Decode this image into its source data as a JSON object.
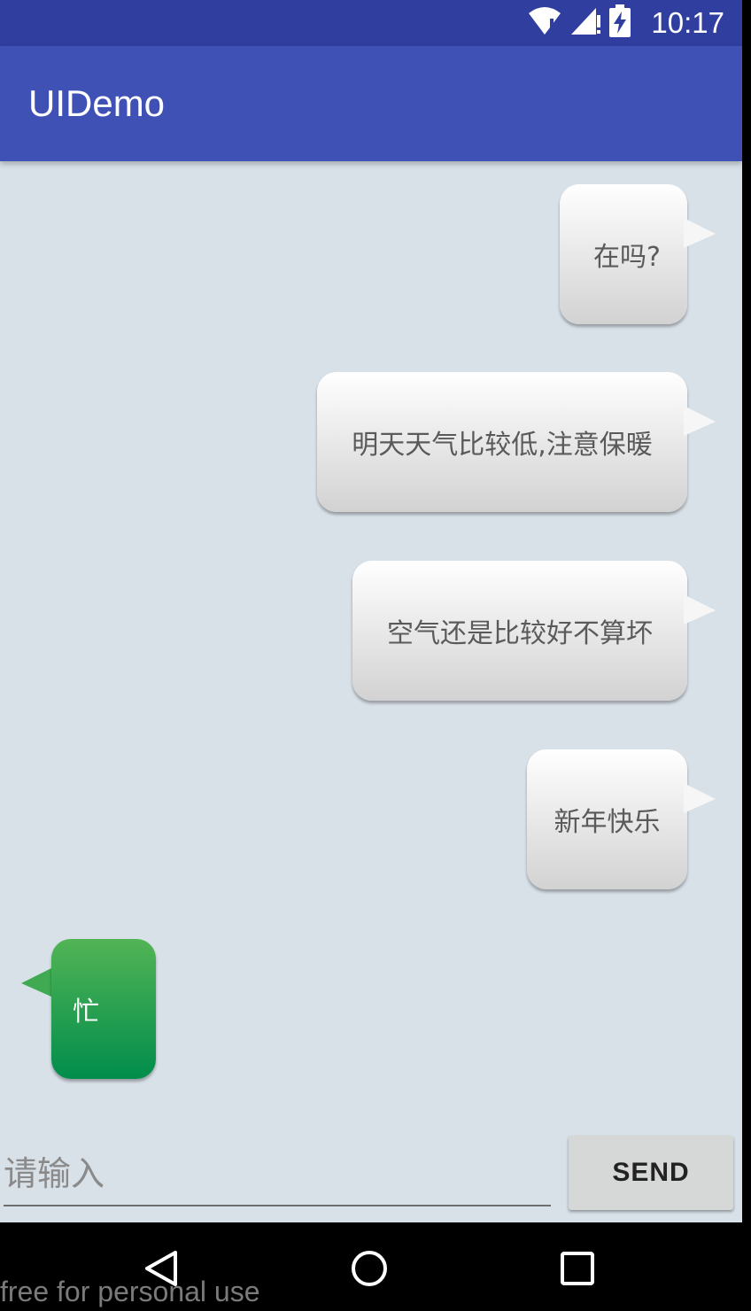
{
  "status_bar": {
    "time": "10:17",
    "icons": [
      "wifi-icon",
      "signal-icon",
      "battery-charging-icon"
    ]
  },
  "app_bar": {
    "title": "UIDemo"
  },
  "messages": [
    {
      "side": "right",
      "text": "在吗?"
    },
    {
      "side": "right",
      "text": "明天天气比较低,注意保暖"
    },
    {
      "side": "right",
      "text": "空气还是比较好不算坏"
    },
    {
      "side": "right",
      "text": "新年快乐"
    },
    {
      "side": "left",
      "text": "忙"
    }
  ],
  "input": {
    "placeholder": "请输入",
    "value": ""
  },
  "send_button": {
    "label": "SEND"
  },
  "nav_bar": {
    "buttons": [
      "back-icon",
      "home-icon",
      "recents-icon"
    ]
  },
  "watermark": "free for personal use",
  "colors": {
    "status_bar": "#303f9f",
    "app_bar": "#3f51b5",
    "background": "#d8e0e8",
    "incoming_bubble": "#1a9b50"
  }
}
